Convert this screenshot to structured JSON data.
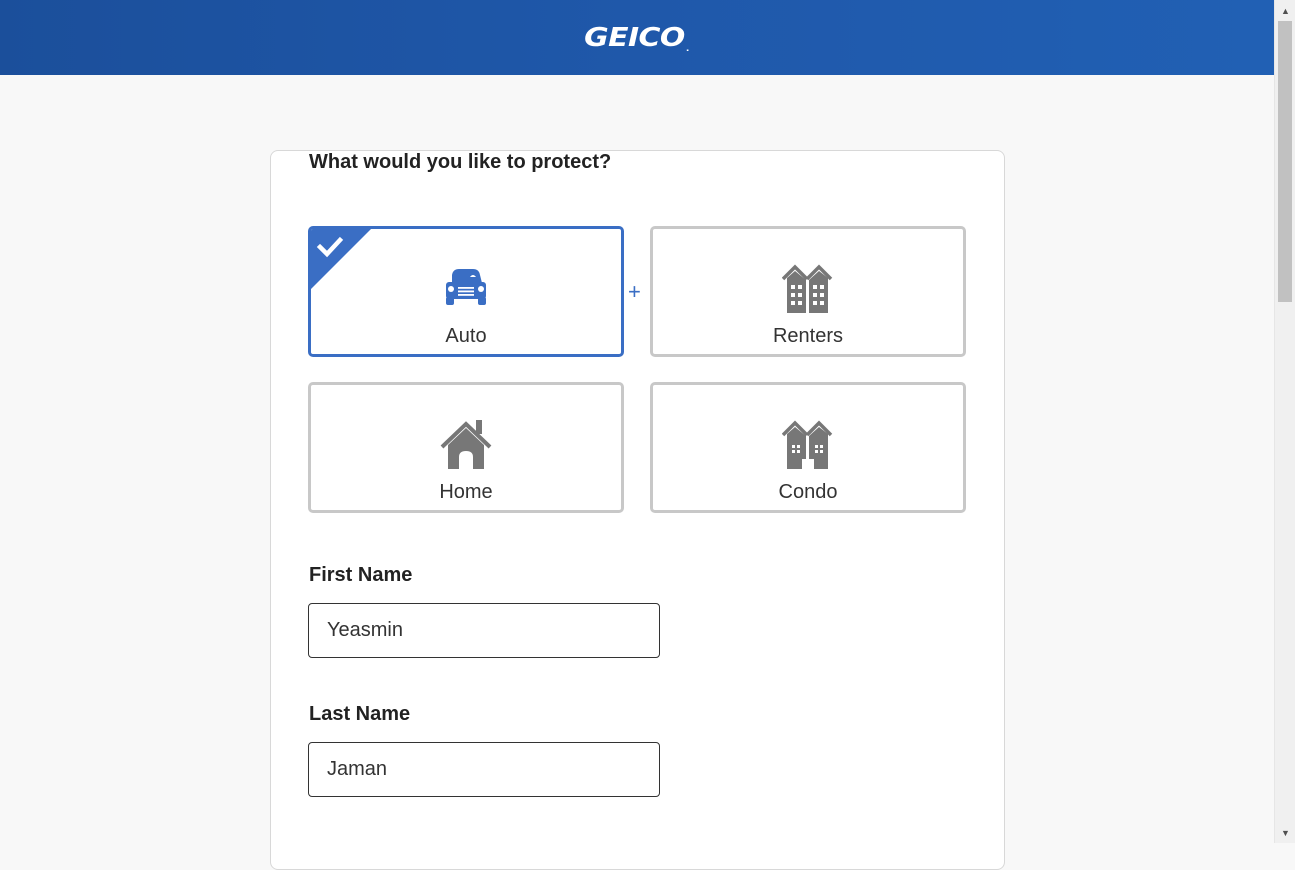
{
  "header": {
    "logo_text": "GEICO",
    "logo_mark": ".",
    "background_color": "#1f58aa"
  },
  "question": "What would you like to protect?",
  "products": [
    {
      "label": "Auto",
      "icon": "car-icon",
      "selected": true
    },
    {
      "label": "Renters",
      "icon": "apartment-building-icon",
      "selected": false
    },
    {
      "label": "Home",
      "icon": "house-icon",
      "selected": false
    },
    {
      "label": "Condo",
      "icon": "condo-building-icon",
      "selected": false
    }
  ],
  "bundle_separator": "+",
  "form": {
    "first_name_label": "First Name",
    "first_name_value": "Yeasmin",
    "last_name_label": "Last Name",
    "last_name_value": "Jaman"
  },
  "colors": {
    "accent": "#3a6ec4",
    "icon_gray": "#777777",
    "tile_border": "#c8c8c8"
  }
}
